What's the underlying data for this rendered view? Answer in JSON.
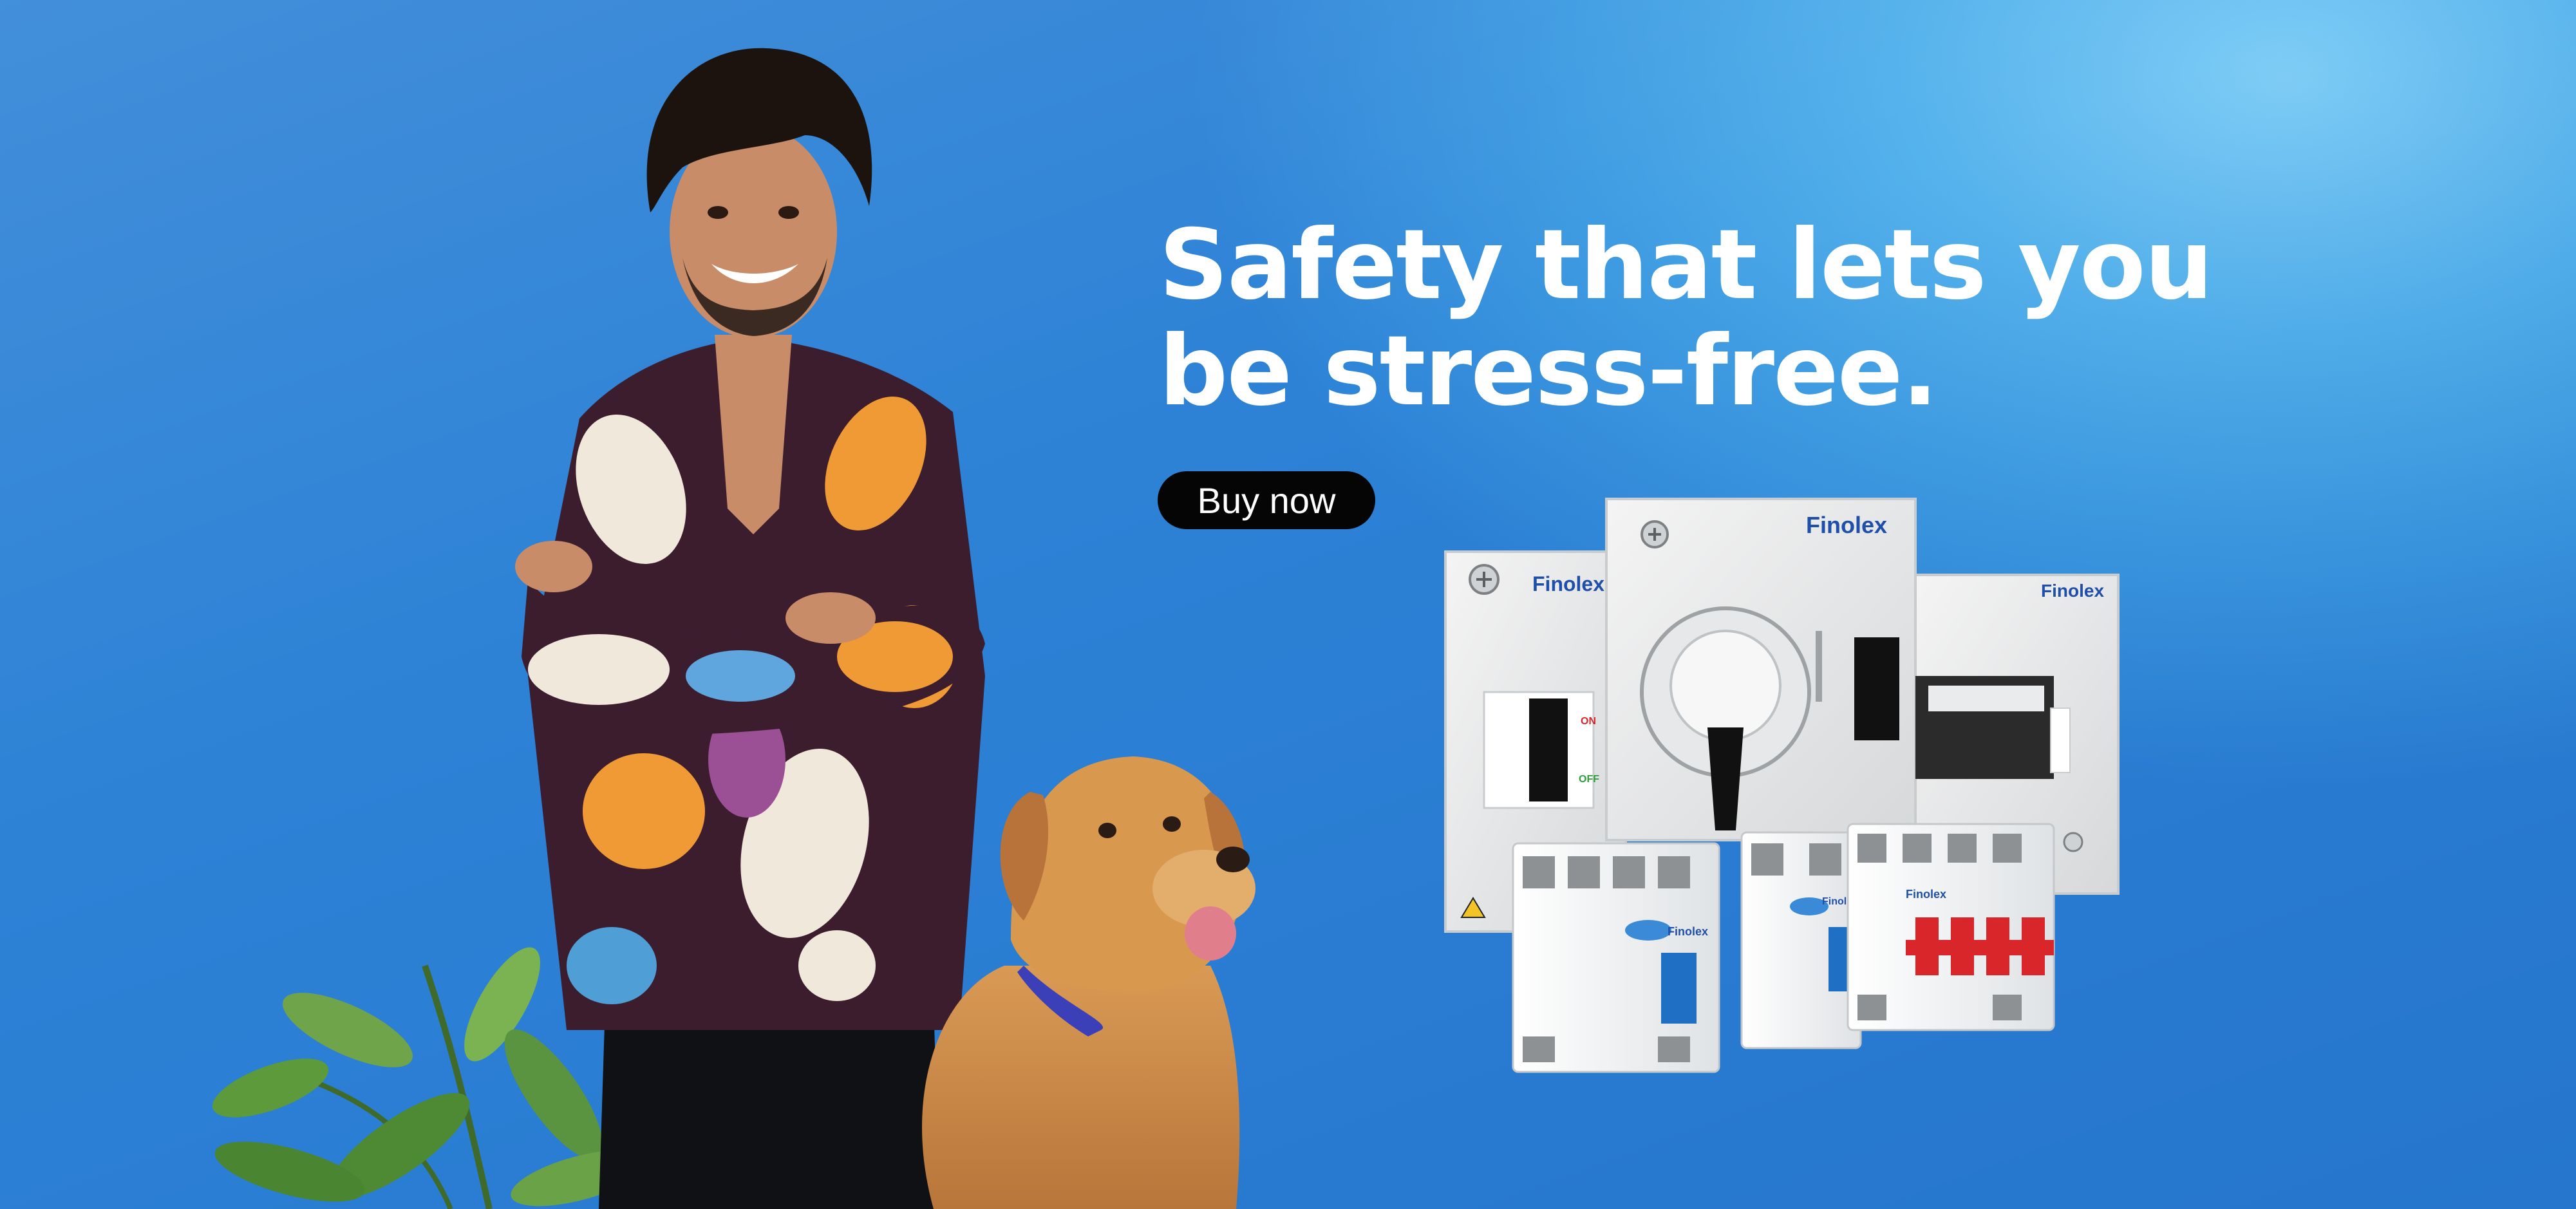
{
  "hero": {
    "headline_line1": "Safety that lets you",
    "headline_line2": "be stress-free.",
    "cta_label": "Buy now"
  },
  "products": {
    "brand": "Finolex",
    "switch_on": "ON",
    "switch_off": "OFF"
  },
  "colors": {
    "background_light": "#7fcdf6",
    "background_dark": "#2d82d6",
    "headline": "#ffffff",
    "button_bg": "#050505",
    "button_text": "#ffffff",
    "brand_blue": "#1f4fa8",
    "mcb_red": "#d8262b"
  },
  "icons": {
    "cta": "none",
    "enclosure_screw": "screw-icon",
    "warning": "warning-triangle-icon"
  }
}
